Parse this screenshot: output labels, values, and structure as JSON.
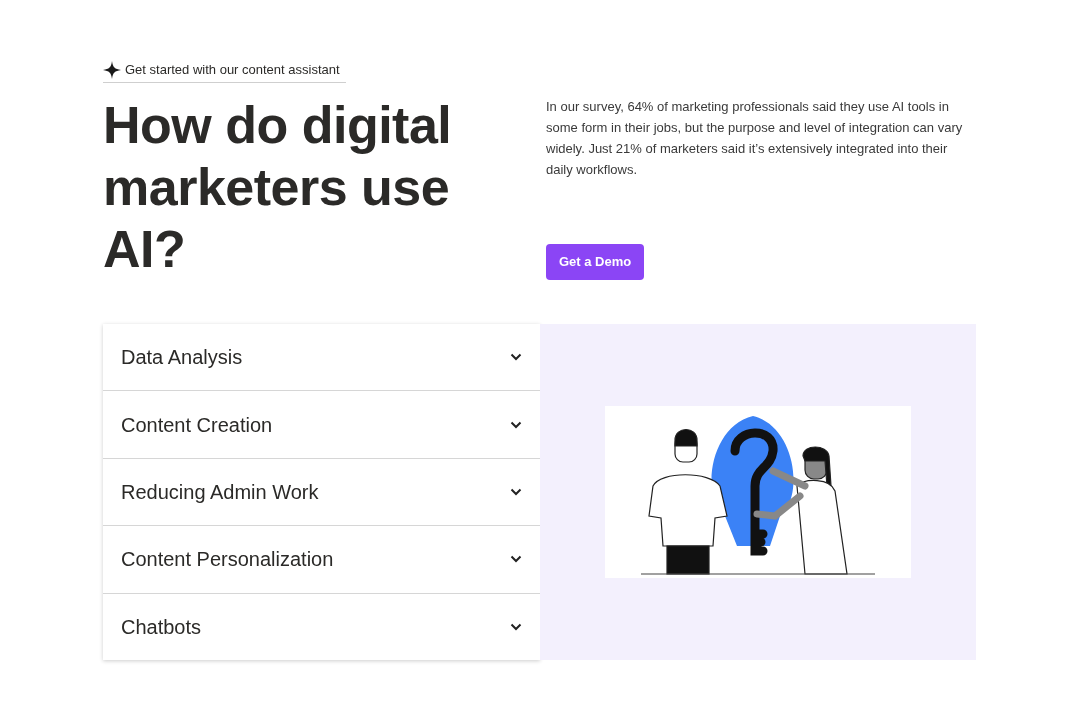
{
  "eyebrow": "Get started with our content assistant",
  "heading": "How do digital marketers use AI?",
  "intro": "In our survey, 64% of marketing professionals said they use AI tools in some form in their jobs, but the purpose and level of integration can vary widely. Just 21% of marketers said it’s extensively integrated into their daily workflows.",
  "cta": "Get a Demo",
  "accordion": [
    {
      "label": "Data Analysis",
      "expanded": false
    },
    {
      "label": "Content Creation",
      "expanded": false
    },
    {
      "label": "Reducing Admin Work",
      "expanded": false
    },
    {
      "label": "Content Personalization",
      "expanded": false
    },
    {
      "label": "Chatbots",
      "expanded": false
    }
  ]
}
